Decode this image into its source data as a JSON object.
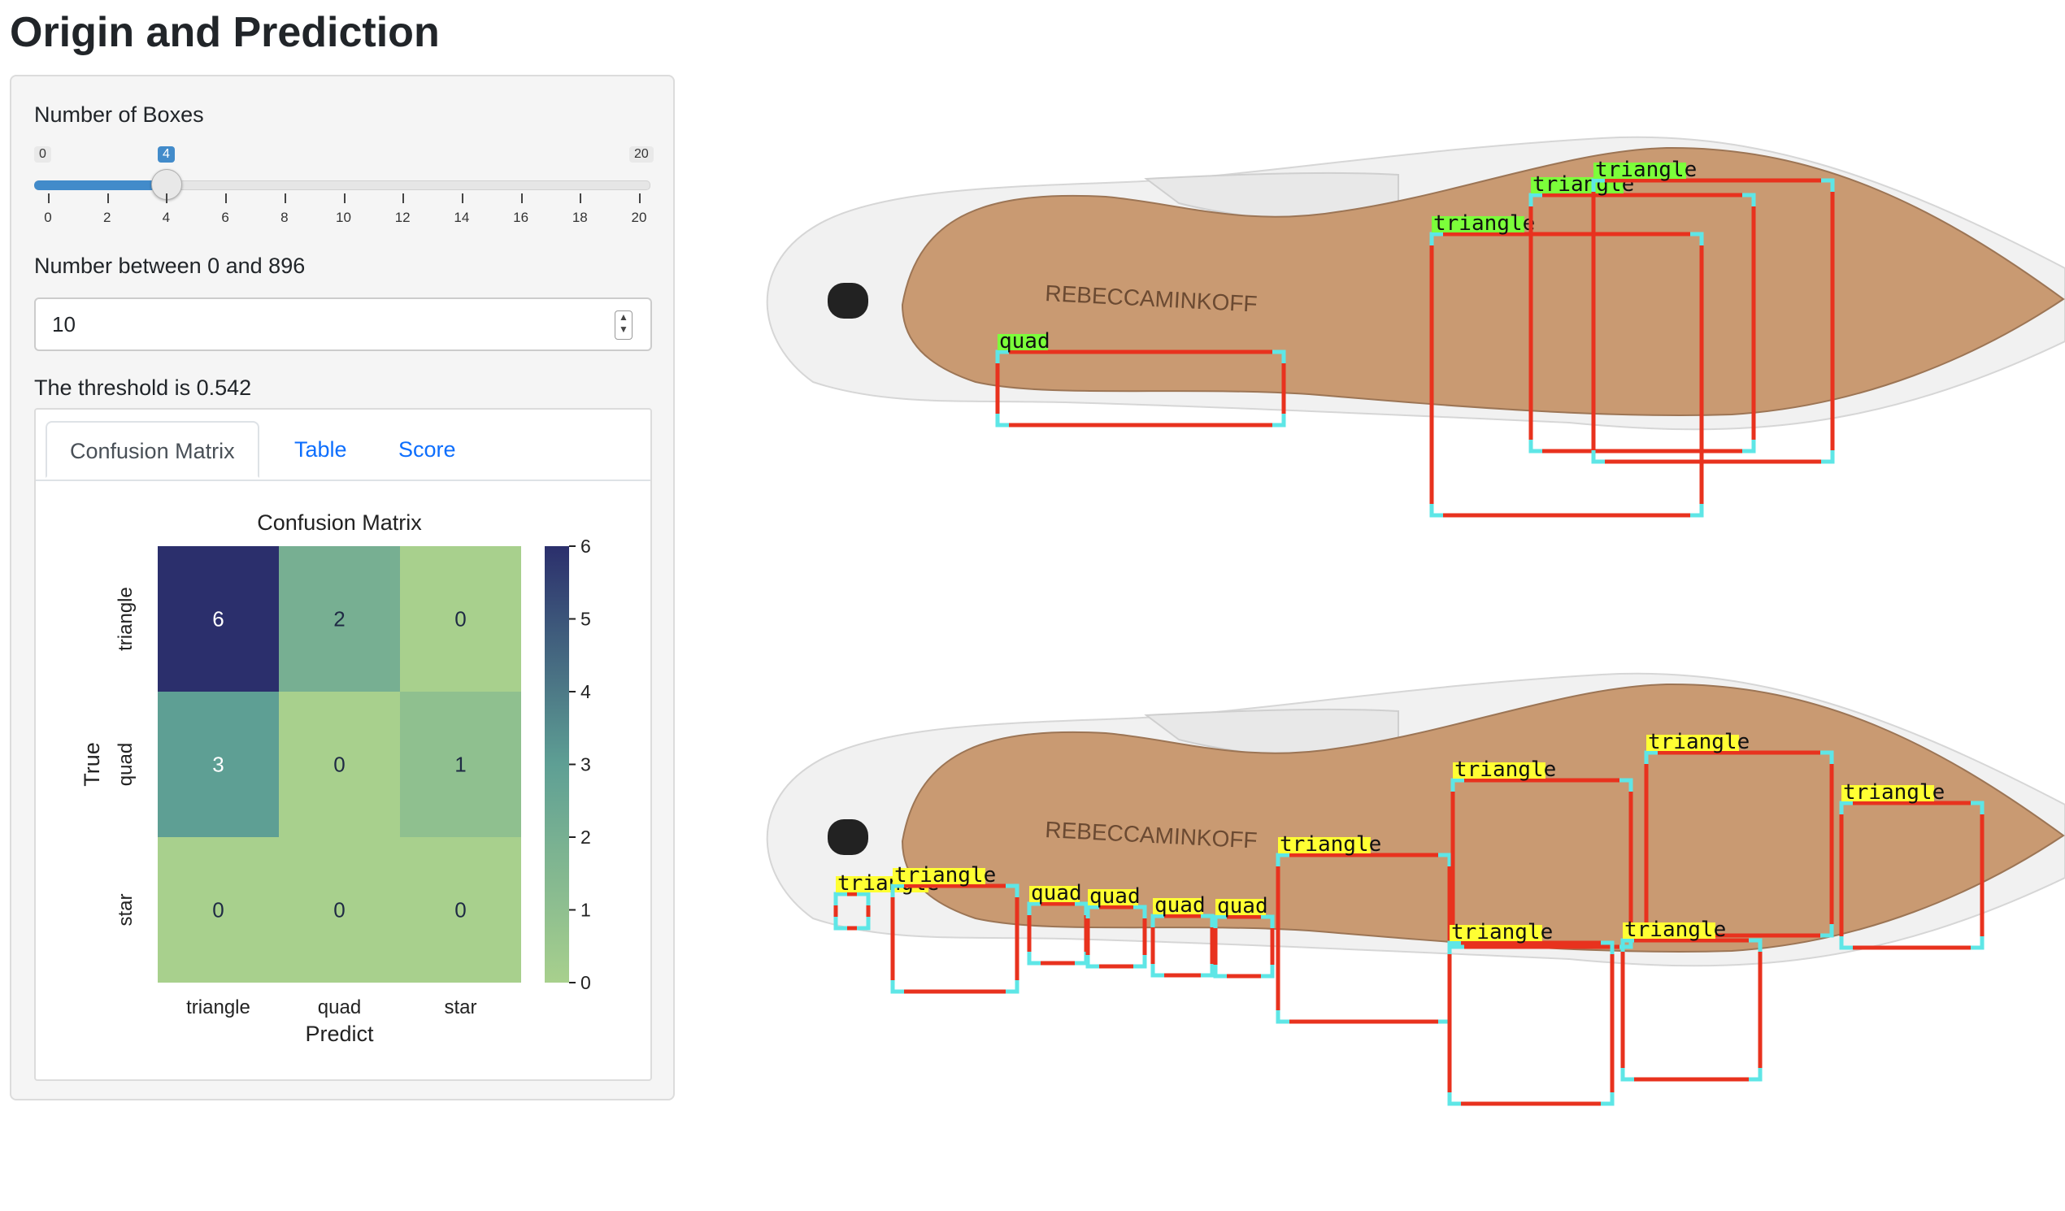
{
  "title": "Origin and Prediction",
  "sidebar": {
    "slider_label": "Number of Boxes",
    "slider_min": "0",
    "slider_max": "20",
    "slider_value": "4",
    "slider_ticks": [
      "0",
      "2",
      "4",
      "6",
      "8",
      "10",
      "12",
      "14",
      "16",
      "18",
      "20"
    ],
    "number_label": "Number between 0 and 896",
    "number_value": "10",
    "threshold_text": "The threshold is 0.542",
    "tabs": [
      {
        "label": "Confusion Matrix",
        "active": true
      },
      {
        "label": "Table",
        "active": false
      },
      {
        "label": "Score",
        "active": false
      }
    ]
  },
  "chart_data": {
    "type": "heatmap",
    "title": "Confusion Matrix",
    "xlabel": "Predict",
    "ylabel": "True",
    "x_categories": [
      "triangle",
      "quad",
      "star"
    ],
    "y_categories": [
      "triangle",
      "quad",
      "star"
    ],
    "values": [
      [
        6,
        2,
        0
      ],
      [
        3,
        0,
        1
      ],
      [
        0,
        0,
        0
      ]
    ],
    "colorbar_ticks": [
      "0",
      "1",
      "2",
      "3",
      "4",
      "5",
      "6"
    ],
    "colorbar_range": [
      0,
      6
    ],
    "colormap": [
      "#a8d08d",
      "#5e9f94",
      "#2b2f6c"
    ]
  },
  "images": {
    "origin": {
      "label_color": "#7cff3a",
      "boxes": [
        {
          "label": "quad"
        },
        {
          "label": "triangle"
        },
        {
          "label": "triangle"
        },
        {
          "label": "triangle"
        }
      ]
    },
    "prediction": {
      "label_color": "#ffff33",
      "boxes": [
        {
          "label": "triangle"
        },
        {
          "label": "triangle"
        },
        {
          "label": "quad"
        },
        {
          "label": "quad"
        },
        {
          "label": "quad"
        },
        {
          "label": "quad"
        },
        {
          "label": "triangle"
        },
        {
          "label": "triangle"
        },
        {
          "label": "triangle"
        },
        {
          "label": "triangle"
        },
        {
          "label": "triangle"
        },
        {
          "label": "triangle"
        }
      ]
    },
    "sole_text": "REBECCAMINKOFF",
    "box_color": "#e8321e",
    "corner_color": "#5ee6e6"
  }
}
